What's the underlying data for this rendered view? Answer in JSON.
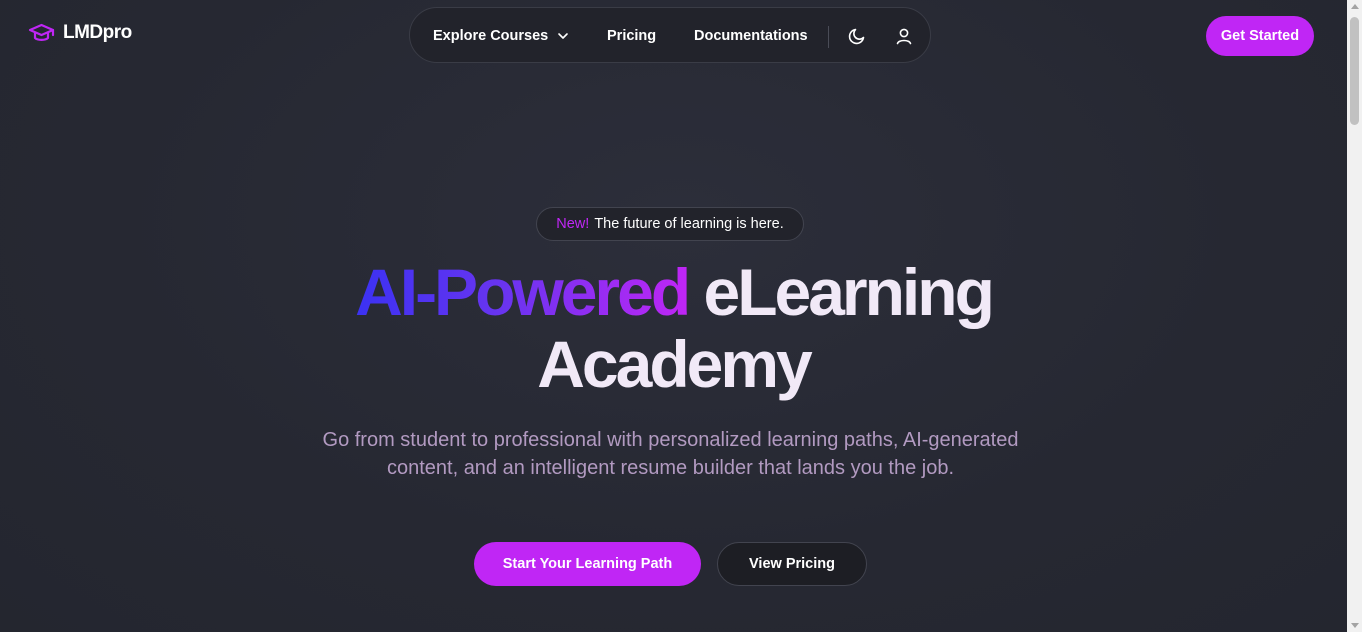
{
  "brand": {
    "name": "LMDpro",
    "icon": "graduation-cap-icon",
    "accent_color": "#c026f5"
  },
  "nav": {
    "items": [
      {
        "label": "Explore Courses",
        "has_dropdown": true
      },
      {
        "label": "Pricing"
      },
      {
        "label": "Documentations"
      }
    ],
    "theme_toggle_icon": "moon-icon",
    "account_icon": "user-icon"
  },
  "header": {
    "cta_label": "Get Started"
  },
  "hero": {
    "badge_new": "New!",
    "badge_text": "The future of learning is here.",
    "headline_highlight": "AI-Powered",
    "headline_rest_1": "eLearning",
    "headline_rest_2": "Academy",
    "subtitle": "Go from student to professional with personalized learning paths, AI-generated content, and an intelligent resume builder that lands you the job.",
    "primary_button": "Start Your Learning Path",
    "secondary_button": "View Pricing"
  }
}
